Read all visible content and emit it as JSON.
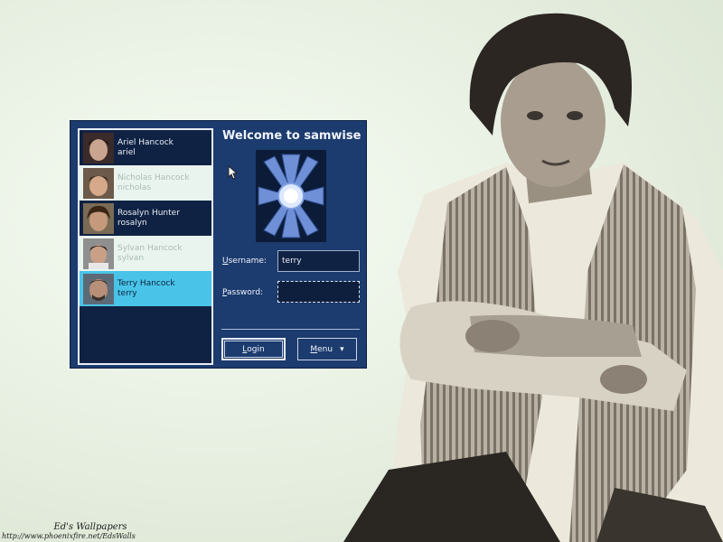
{
  "welcome": {
    "title": "Welcome to samwise"
  },
  "users": [
    {
      "name": "Ariel Hancock",
      "login": "ariel",
      "state": "dark"
    },
    {
      "name": "Nicholas Hancock",
      "login": "nicholas",
      "state": "light"
    },
    {
      "name": "Rosalyn Hunter",
      "login": "rosalyn",
      "state": "dark"
    },
    {
      "name": "Sylvan Hancock",
      "login": "sylvan",
      "state": "light"
    },
    {
      "name": "Terry Hancock",
      "login": "terry",
      "state": "selected"
    }
  ],
  "form": {
    "username_label": "sername:",
    "username_mnemonic": "U",
    "username_value": "terry",
    "password_label": "assword:",
    "password_mnemonic": "P",
    "password_value": ""
  },
  "buttons": {
    "login_mnemonic": "L",
    "login_rest": "ogin",
    "menu_mnemonic": "M",
    "menu_rest": "enu",
    "menu_arrow": "▾"
  },
  "watermark": {
    "title": "Ed's Wallpapers",
    "url": "http://www.phoenixfire.net/EdsWalls"
  },
  "colors": {
    "dialog_bg": "#1c3b6e",
    "list_bg": "#0f2243",
    "selected_row": "#49c4e8",
    "light_row": "#eaf4ee"
  }
}
